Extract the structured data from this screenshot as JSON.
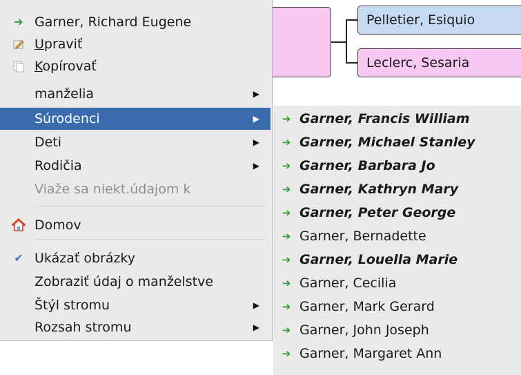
{
  "chart": {
    "person_top": "Pelletier, Esiquio",
    "person_bottom": "Leclerc, Sesaria"
  },
  "menu": {
    "items": [
      {
        "label": "Garner, Richard Eugene",
        "icon": "person-arrow-icon"
      },
      {
        "label": "Upraviť",
        "icon": "edit-icon",
        "mnemonic": "U"
      },
      {
        "label": "Kopírovať",
        "icon": "copy-icon",
        "mnemonic": "K"
      },
      {
        "label": "manželia",
        "submenu": true
      },
      {
        "label": "Súrodenci",
        "submenu": true,
        "selected": true
      },
      {
        "label": "Deti",
        "submenu": true
      },
      {
        "label": "Rodičia",
        "submenu": true
      },
      {
        "label": "Viaže sa niekt.údajom k",
        "disabled": true
      },
      {
        "label": "Domov",
        "icon": "home-icon"
      },
      {
        "label": "Ukázať obrázky",
        "icon": "check-icon"
      },
      {
        "label": "Zobraziť údaj o manželstve"
      },
      {
        "label": "Štýl stromu",
        "submenu": true
      },
      {
        "label": "Rozsah stromu",
        "submenu": true
      }
    ]
  },
  "submenu": {
    "title": "Súrodenci",
    "items": [
      {
        "label": "Garner, Francis William",
        "bold": true
      },
      {
        "label": "Garner, Michael Stanley",
        "bold": true
      },
      {
        "label": "Garner, Barbara Jo",
        "bold": true
      },
      {
        "label": "Garner, Kathryn Mary",
        "bold": true
      },
      {
        "label": "Garner, Peter George",
        "bold": true
      },
      {
        "label": "Garner, Bernadette",
        "bold": false
      },
      {
        "label": "Garner, Louella Marie",
        "bold": true
      },
      {
        "label": "Garner, Cecilia",
        "bold": false
      },
      {
        "label": "Garner, Mark Gerard",
        "bold": false
      },
      {
        "label": "Garner, John Joseph",
        "bold": false
      },
      {
        "label": "Garner, Margaret Ann",
        "bold": false
      }
    ]
  },
  "colors": {
    "selection": "#3a6cad",
    "menu_bg": "#eaeaea",
    "female_box": "#f8c8f2",
    "male_box": "#c6daf3",
    "person_icon": "#2f9a2f"
  }
}
